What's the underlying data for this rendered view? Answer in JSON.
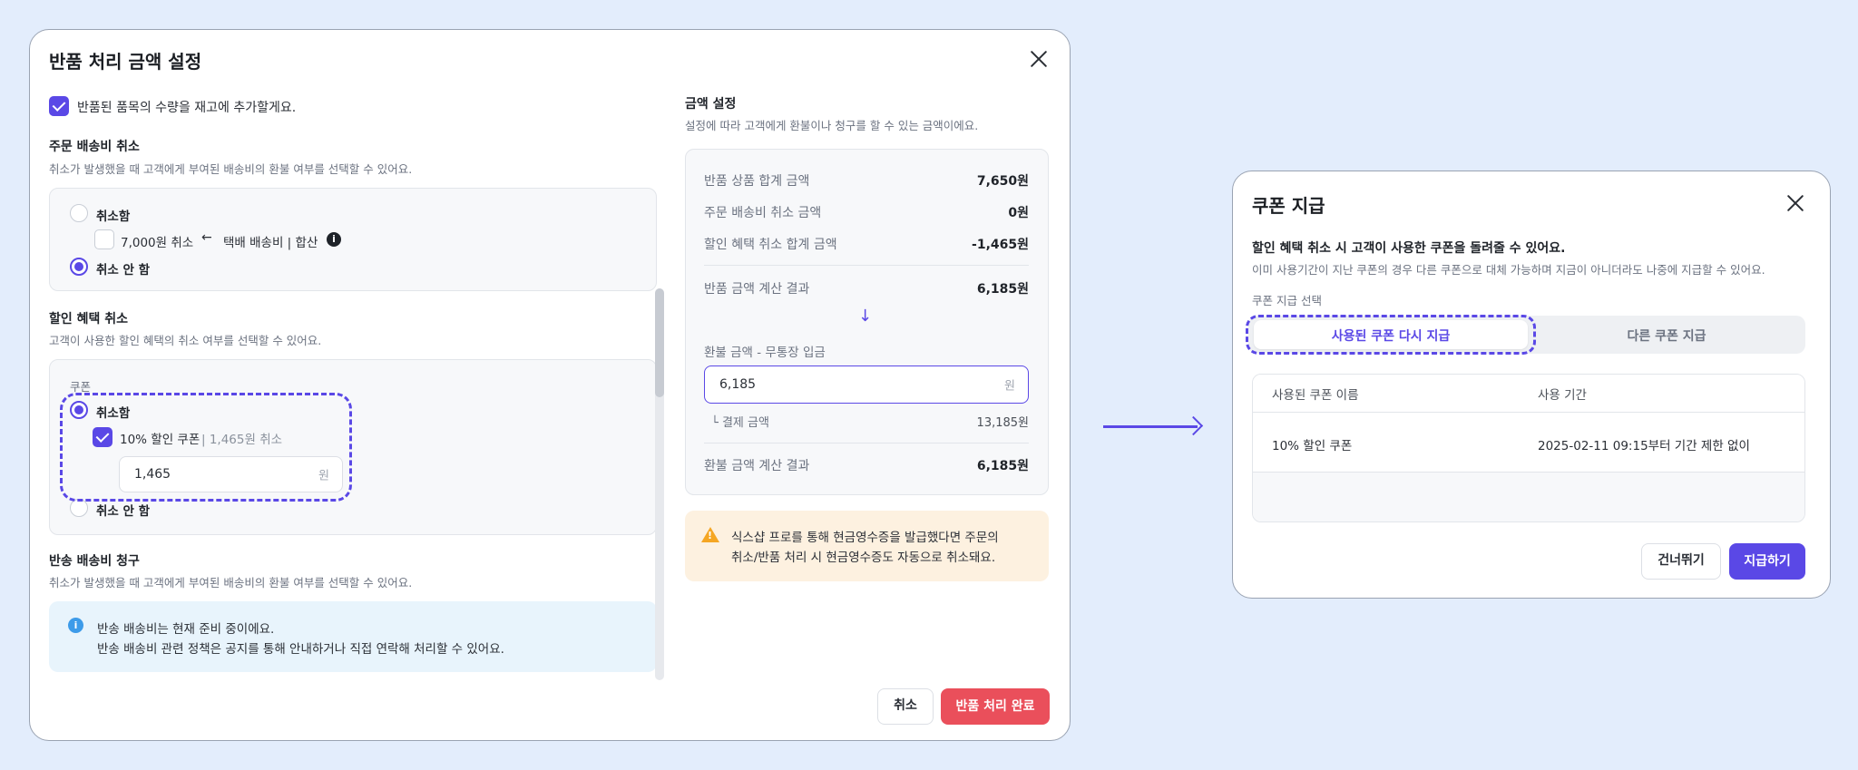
{
  "return_modal": {
    "title": "반품 처리 금액 설정",
    "restock_label": "반품된 품목의 수량을 재고에 추가할게요.",
    "shipping_cancel": {
      "title": "주문 배송비 취소",
      "desc": "취소가 발생했을 때 고객에게 부여된 배송비의 환불 여부를 선택할 수 있어요.",
      "option_cancel": "취소함",
      "sub_amount": "7,000원 취소",
      "sub_arrow": "←",
      "sub_detail": "택배 배송비 | 합산",
      "option_no_cancel": "취소 안 함"
    },
    "discount_cancel": {
      "title": "할인 혜택 취소",
      "desc": "고객이 사용한 할인 혜택의 취소 여부를 선택할 수 있어요.",
      "coupon_label": "쿠폰",
      "option_cancel": "취소함",
      "coupon_name": "10% 할인 쿠폰",
      "coupon_cancel_amount": "| 1,465원 취소",
      "input_value": "1,465",
      "input_unit": "원",
      "option_no_cancel": "취소 안 함"
    },
    "return_shipping": {
      "title": "반송 배송비 청구",
      "desc": "취소가 발생했을 때 고객에게 부여된 배송비의 환불 여부를 선택할 수 있어요.",
      "info_line1": "반송 배송비는 현재 준비 중이에요.",
      "info_line2": "반송 배송비 관련 정책은 공지를 통해 안내하거나 직접 연락해 처리할 수 있어요."
    },
    "amount": {
      "title": "금액 설정",
      "desc": "설정에 따라 고객에게 환불이나 청구를 할 수 있는 금액이에요.",
      "rows": [
        {
          "label": "반품 상품 합계 금액",
          "value": "7,650원"
        },
        {
          "label": "주문 배송비 취소 금액",
          "value": "0원"
        },
        {
          "label": "할인 혜택 취소 합계 금액",
          "value": "-1,465원"
        }
      ],
      "calc_label": "반품 금액 계산 결과",
      "calc_value": "6,185원",
      "down_arrow": "↓",
      "refund_label": "환불 금액 - 무통장 입금",
      "refund_input": "6,185",
      "refund_unit": "원",
      "payment_label": "└ 결제 금액",
      "payment_value": "13,185원",
      "final_label": "환불 금액 계산 결과",
      "final_value": "6,185원"
    },
    "warning_line1": "식스샵 프로를 통해 현금영수증을 발급했다면 주문의",
    "warning_line2": "취소/반품 처리 시 현금영수증도 자동으로 취소돼요.",
    "cancel_button": "취소",
    "confirm_button": "반품 처리 완료"
  },
  "coupon_modal": {
    "title": "쿠폰 지급",
    "headline": "할인 혜택 취소 시 고객이 사용한 쿠폰을 돌려줄 수 있어요.",
    "desc": "이미 사용기간이 지난 쿠폰의 경우 다른 쿠폰으로 대체 가능하며 지금이 아니더라도 나중에 지급할 수 있어요.",
    "select_label": "쿠폰 지급 선택",
    "tabs": [
      "사용된 쿠폰 다시 지급",
      "다른 쿠폰 지급"
    ],
    "table_headers": [
      "사용된 쿠폰 이름",
      "사용 기간"
    ],
    "table_rows": [
      [
        "10% 할인 쿠폰",
        "2025-02-11 09:15부터 기간 제한 없이"
      ]
    ],
    "skip_button": "건너뛰기",
    "issue_button": "지급하기"
  },
  "colors": {
    "background": "#e3edfc",
    "accent": "#5a48e6",
    "danger": "#ea4f5b",
    "warning_bg": "#fdf1e0",
    "info_bg": "#e8f4fc"
  }
}
